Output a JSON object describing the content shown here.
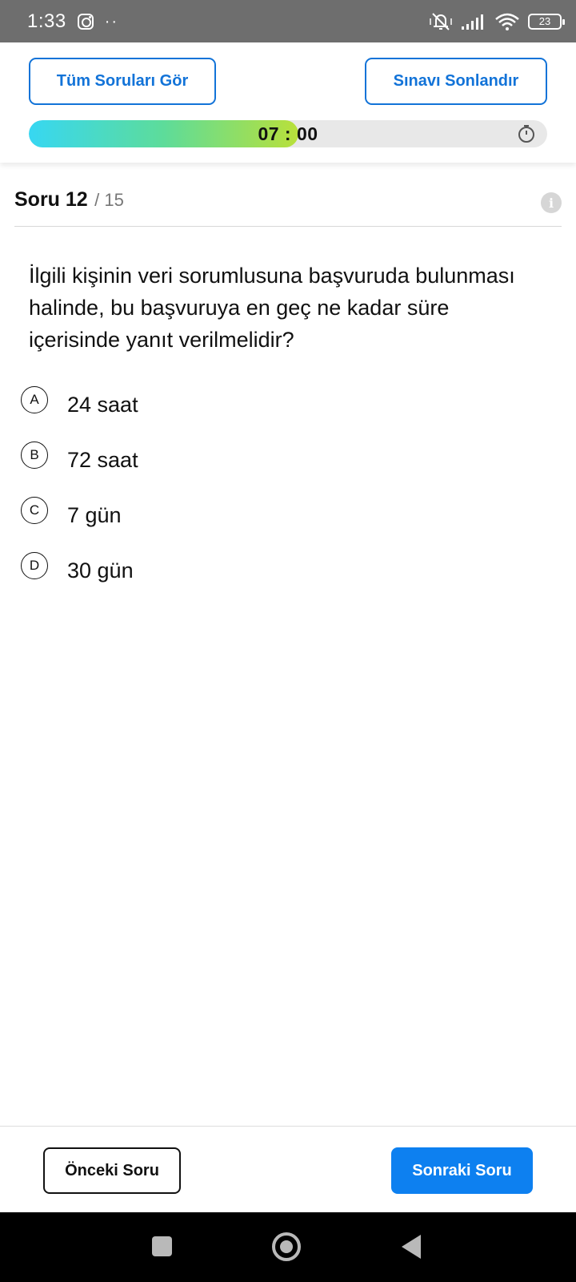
{
  "status_bar": {
    "time": "1:33",
    "left_icons": [
      "instagram-icon",
      "more-dots-icon"
    ],
    "right_icons": [
      "mute-vibrate-icon",
      "signal-icon",
      "wifi-icon"
    ],
    "battery": "23"
  },
  "header": {
    "all_questions_label": "Tüm Soruları Gör",
    "finish_exam_label": "Sınavı Sonlandır",
    "timer": {
      "time": "07 : 00",
      "progress": 0.52,
      "icon": "stopwatch-icon",
      "colors": [
        "#37d7f2",
        "#5ddc9a",
        "#b9e03a"
      ]
    }
  },
  "question": {
    "label": "Soru 12",
    "total": "/ 15",
    "text": "İlgili kişinin veri sorumlusuna başvuruda bulunması halinde, bu başvuruya en geç ne kadar süre içerisinde yanıt verilmelidir?",
    "options": [
      {
        "letter": "A",
        "text": "24 saat"
      },
      {
        "letter": "B",
        "text": "72 saat"
      },
      {
        "letter": "C",
        "text": "7 gün"
      },
      {
        "letter": "D",
        "text": "30 gün"
      }
    ]
  },
  "footer": {
    "prev_label": "Önceki Soru",
    "next_label": "Sonraki Soru"
  },
  "colors": {
    "accent": "#1273d8",
    "primary_button": "#0d80f0",
    "status_bar": "#6e6e6e"
  },
  "nav_bar": {
    "icons": [
      "recent-apps-icon",
      "home-icon",
      "back-icon"
    ]
  }
}
